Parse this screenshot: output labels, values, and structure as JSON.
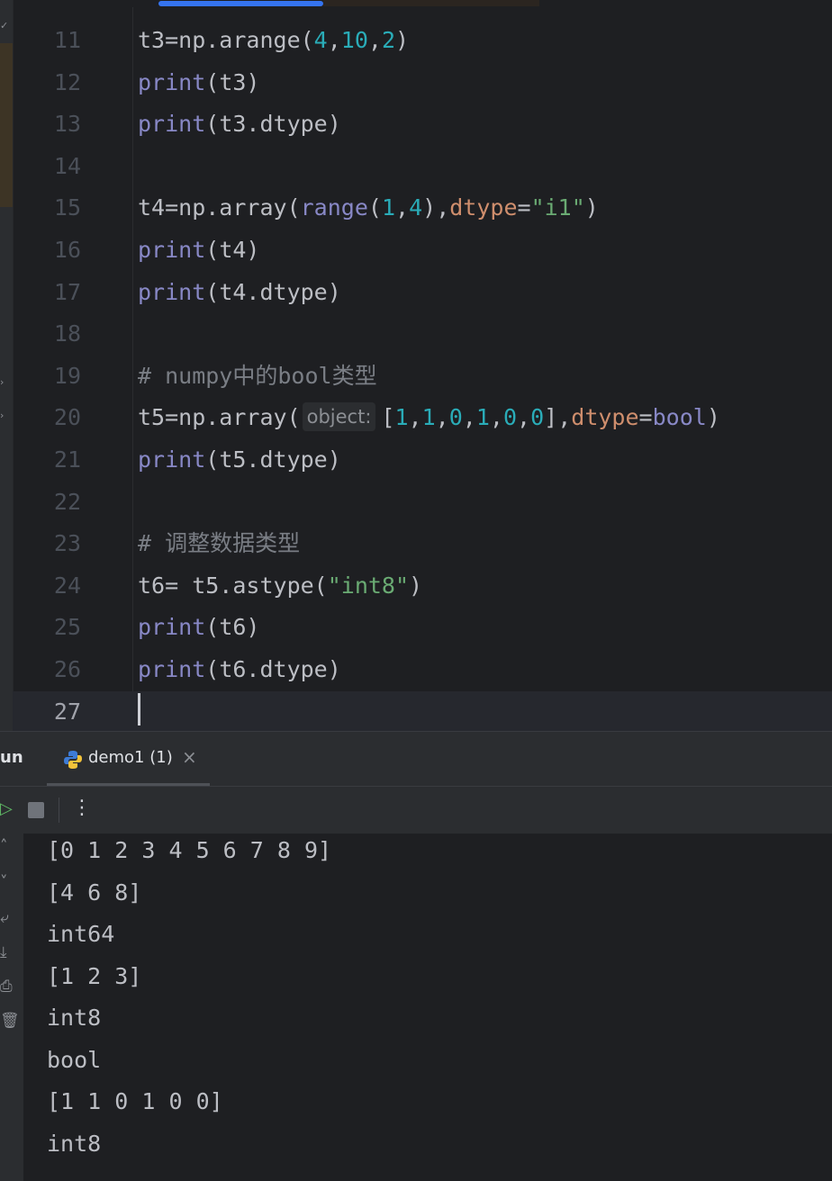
{
  "editor": {
    "lines": [
      {
        "num": "11",
        "tokens": [
          {
            "t": "t3=np.arange(",
            "c": ""
          },
          {
            "t": "4",
            "c": "num"
          },
          {
            "t": ",",
            "c": ""
          },
          {
            "t": "10",
            "c": "num"
          },
          {
            "t": ",",
            "c": ""
          },
          {
            "t": "2",
            "c": "num"
          },
          {
            "t": ")",
            "c": ""
          }
        ]
      },
      {
        "num": "12",
        "tokens": [
          {
            "t": "print",
            "c": "kw-call"
          },
          {
            "t": "(t3)",
            "c": ""
          }
        ]
      },
      {
        "num": "13",
        "tokens": [
          {
            "t": "print",
            "c": "kw-call"
          },
          {
            "t": "(t3.dtype)",
            "c": ""
          }
        ]
      },
      {
        "num": "14",
        "tokens": []
      },
      {
        "num": "15",
        "tokens": [
          {
            "t": "t4=np.array(",
            "c": ""
          },
          {
            "t": "range",
            "c": "kw-call"
          },
          {
            "t": "(",
            "c": ""
          },
          {
            "t": "1",
            "c": "num"
          },
          {
            "t": ",",
            "c": ""
          },
          {
            "t": "4",
            "c": "num"
          },
          {
            "t": "),",
            "c": ""
          },
          {
            "t": "dtype",
            "c": "param"
          },
          {
            "t": "=",
            "c": ""
          },
          {
            "t": "\"i1\"",
            "c": "str"
          },
          {
            "t": ")",
            "c": ""
          }
        ]
      },
      {
        "num": "16",
        "tokens": [
          {
            "t": "print",
            "c": "kw-call"
          },
          {
            "t": "(t4)",
            "c": ""
          }
        ]
      },
      {
        "num": "17",
        "tokens": [
          {
            "t": "print",
            "c": "kw-call"
          },
          {
            "t": "(t4.dtype)",
            "c": ""
          }
        ]
      },
      {
        "num": "18",
        "tokens": []
      },
      {
        "num": "19",
        "tokens": [
          {
            "t": "# numpy中的bool类型",
            "c": "comment"
          }
        ]
      },
      {
        "num": "20",
        "tokens": [
          {
            "t": "t5=np.array(",
            "c": ""
          },
          {
            "t": "object:",
            "c": "hint"
          },
          {
            "t": "[",
            "c": ""
          },
          {
            "t": "1",
            "c": "num"
          },
          {
            "t": ",",
            "c": ""
          },
          {
            "t": "1",
            "c": "num"
          },
          {
            "t": ",",
            "c": ""
          },
          {
            "t": "0",
            "c": "num"
          },
          {
            "t": ",",
            "c": ""
          },
          {
            "t": "1",
            "c": "num"
          },
          {
            "t": ",",
            "c": ""
          },
          {
            "t": "0",
            "c": "num"
          },
          {
            "t": ",",
            "c": ""
          },
          {
            "t": "0",
            "c": "num"
          },
          {
            "t": "],",
            "c": ""
          },
          {
            "t": "dtype",
            "c": "param"
          },
          {
            "t": "=",
            "c": ""
          },
          {
            "t": "bool",
            "c": "kw-call"
          },
          {
            "t": ")",
            "c": ""
          }
        ]
      },
      {
        "num": "21",
        "tokens": [
          {
            "t": "print",
            "c": "kw-call"
          },
          {
            "t": "(t5.dtype)",
            "c": ""
          }
        ]
      },
      {
        "num": "22",
        "tokens": []
      },
      {
        "num": "23",
        "tokens": [
          {
            "t": "# 调整数据类型",
            "c": "comment"
          }
        ]
      },
      {
        "num": "24",
        "tokens": [
          {
            "t": "t6= t5.astype(",
            "c": ""
          },
          {
            "t": "\"int8\"",
            "c": "str"
          },
          {
            "t": ")",
            "c": ""
          }
        ]
      },
      {
        "num": "25",
        "tokens": [
          {
            "t": "print",
            "c": "kw-call"
          },
          {
            "t": "(t6)",
            "c": ""
          }
        ]
      },
      {
        "num": "26",
        "tokens": [
          {
            "t": "print",
            "c": "kw-call"
          },
          {
            "t": "(t6.dtype)",
            "c": ""
          }
        ]
      },
      {
        "num": "27",
        "tokens": []
      }
    ]
  },
  "run_panel": {
    "title": "Run",
    "title_visible": "un",
    "tab_label": "demo1 (1)",
    "close_glyph": "×",
    "output": [
      "[0 1 2 3 4 5 6 7 8 9]",
      "[4 6 8]",
      "int64",
      "[1 2 3]",
      "int8",
      "bool",
      "[1 1 0 1 0 0]",
      "int8"
    ]
  },
  "icons": {
    "rerun": "rerun-icon",
    "stop": "stop-icon",
    "more": "more-vertical-icon",
    "python": "python-icon"
  },
  "colors": {
    "accent": "#3574f0",
    "number": "#2aacb8",
    "string": "#6aab73",
    "builtin": "#8888c6",
    "param": "#cf8e6d",
    "comment": "#7a7e85"
  }
}
